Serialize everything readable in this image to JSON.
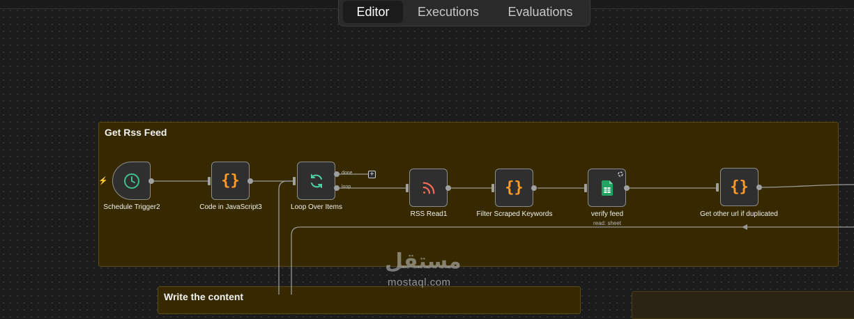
{
  "tabs": [
    {
      "label": "Editor",
      "active": true
    },
    {
      "label": "Executions",
      "active": false
    },
    {
      "label": "Evaluations",
      "active": false
    }
  ],
  "sticky_notes": [
    {
      "title": "Get Rss Feed"
    },
    {
      "title": "Write the content"
    }
  ],
  "nodes": [
    {
      "label": "Schedule Trigger2",
      "icon": "clock-icon"
    },
    {
      "label": "Code in JavaScript3",
      "icon": "code-braces-icon"
    },
    {
      "label": "Loop Over Items",
      "icon": "loop-arrows-icon",
      "outputs": [
        "done",
        "loop"
      ]
    },
    {
      "label": "RSS Read1",
      "icon": "rss-icon"
    },
    {
      "label": "Filter Scraped Keywords",
      "icon": "code-braces-icon"
    },
    {
      "label": "verify feed",
      "sublabel": "read: sheet",
      "icon": "google-sheets-icon"
    },
    {
      "label": "Get other url if duplicated",
      "icon": "code-braces-icon"
    }
  ],
  "watermark": {
    "arabic": "مستقل",
    "latin": "mostaql.com"
  },
  "colors": {
    "accent_orange": "#ff9b26",
    "trigger_green": "#3ec18c",
    "rss_red": "#ff6d5a",
    "sheets_green": "#1fa463",
    "sticky_bg": "#362900"
  }
}
